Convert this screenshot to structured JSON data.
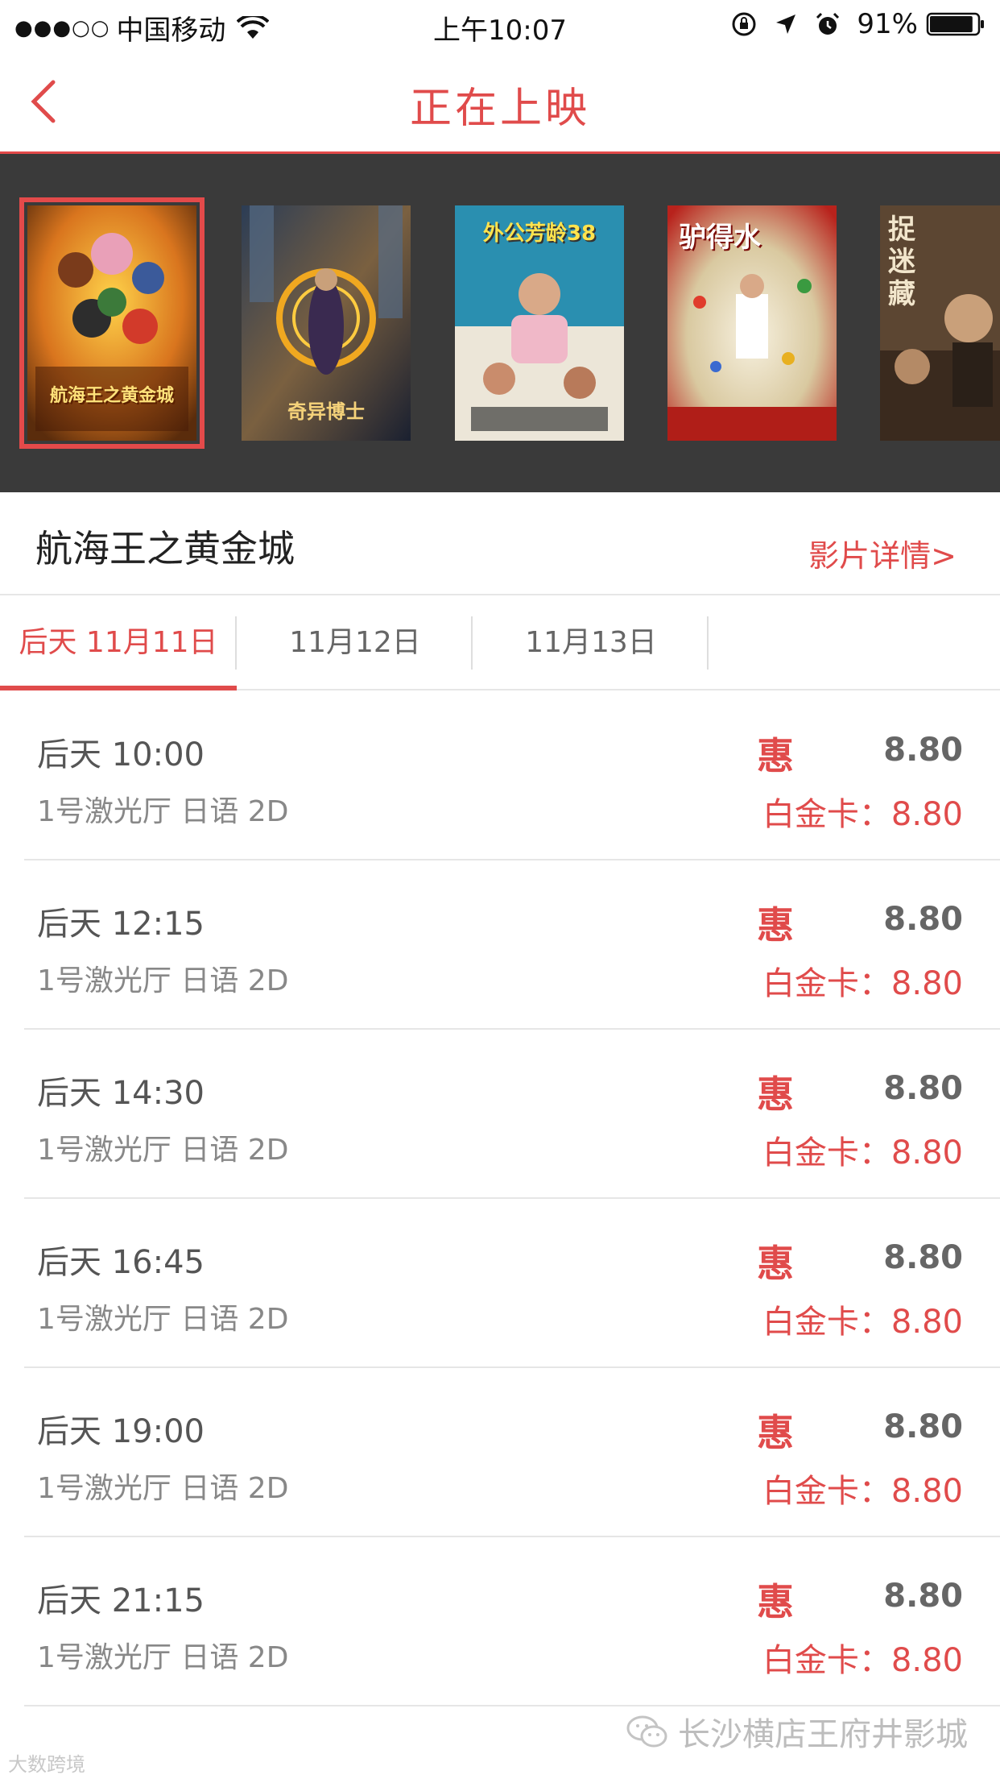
{
  "status_bar": {
    "signal_dots": "●●●○○",
    "carrier": "中国移动",
    "time": "上午10:07",
    "battery_percent": "91%",
    "battery_level": 0.91
  },
  "nav": {
    "title": "正在上映",
    "accent_color": "#e04b4b"
  },
  "posters": [
    {
      "text": "航海王之黄金城",
      "selected": true
    },
    {
      "text": "奇异博士",
      "selected": false
    },
    {
      "text": "外公芳龄38",
      "selected": false
    },
    {
      "text": "驴得水",
      "selected": false
    },
    {
      "text": "捉迷藏",
      "selected": false
    }
  ],
  "movie": {
    "title": "航海王之黄金城",
    "detail_link": "影片详情>"
  },
  "date_tabs": [
    {
      "label": "后天 11月11日",
      "active": true
    },
    {
      "label": "11月12日",
      "active": false
    },
    {
      "label": "11月13日",
      "active": false
    }
  ],
  "showtimes": [
    {
      "time": "后天 10:00",
      "hall": "1号激光厅 日语 2D",
      "badge": "惠",
      "price": "8.80",
      "card_price": "白金卡：8.80"
    },
    {
      "time": "后天 12:15",
      "hall": "1号激光厅 日语 2D",
      "badge": "惠",
      "price": "8.80",
      "card_price": "白金卡：8.80"
    },
    {
      "time": "后天 14:30",
      "hall": "1号激光厅 日语 2D",
      "badge": "惠",
      "price": "8.80",
      "card_price": "白金卡：8.80"
    },
    {
      "time": "后天 16:45",
      "hall": "1号激光厅 日语 2D",
      "badge": "惠",
      "price": "8.80",
      "card_price": "白金卡：8.80"
    },
    {
      "time": "后天 19:00",
      "hall": "1号激光厅 日语 2D",
      "badge": "惠",
      "price": "8.80",
      "card_price": "白金卡：8.80"
    },
    {
      "time": "后天 21:15",
      "hall": "1号激光厅 日语 2D",
      "badge": "惠",
      "price": "8.80",
      "card_price": "白金卡：8.80"
    }
  ],
  "watermarks": {
    "right": "长沙横店王府井影城",
    "left": "大数跨境"
  }
}
